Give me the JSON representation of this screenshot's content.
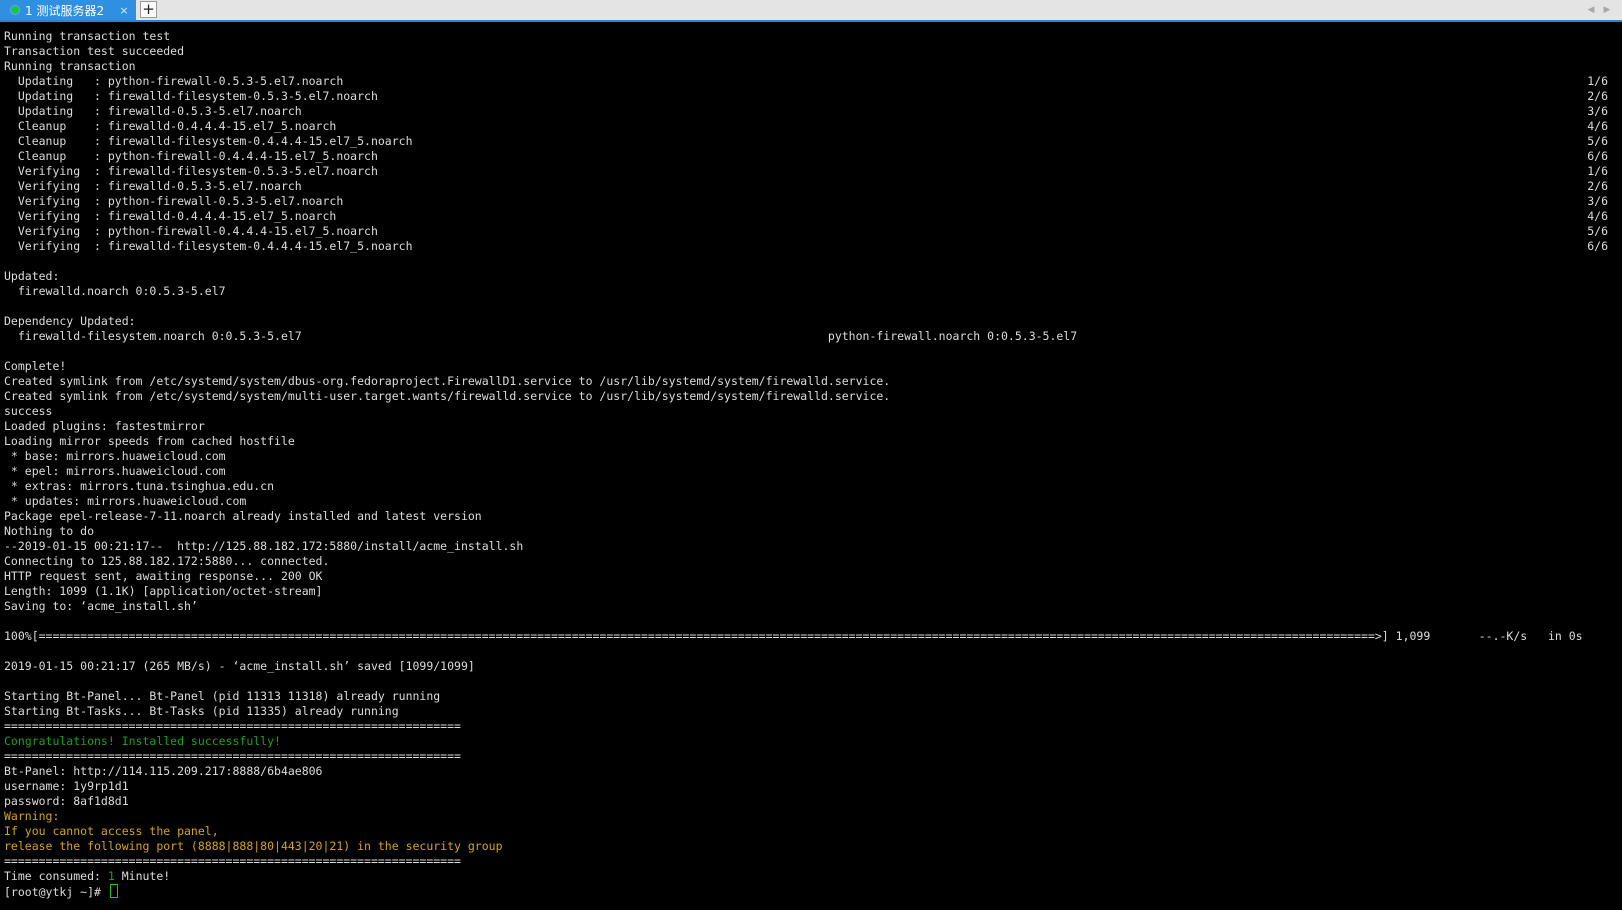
{
  "tab": {
    "title": "1 测试服务器2",
    "close": "×",
    "add": "+"
  },
  "colors": {
    "accent": "#2f8fe0",
    "status": "#19c44a",
    "terminal_bg": "#000000",
    "terminal_fg": "#dcdcdc",
    "success_green": "#1aa11a",
    "warning_yellow": "#d6a218"
  },
  "icons": {
    "status": "green-dot-icon",
    "close": "close-icon",
    "add": "plus-icon",
    "scroll_left": "chevron-left-icon",
    "scroll_right": "chevron-right-icon"
  },
  "terminal": {
    "lines": [
      "Running transaction test",
      "Transaction test succeeded",
      "Running transaction",
      "  Updating   : python-firewall-0.5.3-5.el7.noarch",
      "  Updating   : firewalld-filesystem-0.5.3-5.el7.noarch",
      "  Updating   : firewalld-0.5.3-5.el7.noarch",
      "  Cleanup    : firewalld-0.4.4.4-15.el7_5.noarch",
      "  Cleanup    : firewalld-filesystem-0.4.4.4-15.el7_5.noarch",
      "  Cleanup    : python-firewall-0.4.4.4-15.el7_5.noarch",
      "  Verifying  : firewalld-filesystem-0.5.3-5.el7.noarch",
      "  Verifying  : firewalld-0.5.3-5.el7.noarch",
      "  Verifying  : python-firewall-0.5.3-5.el7.noarch",
      "  Verifying  : firewalld-0.4.4.4-15.el7_5.noarch",
      "  Verifying  : python-firewall-0.4.4.4-15.el7_5.noarch",
      "  Verifying  : firewalld-filesystem-0.4.4.4-15.el7_5.noarch",
      "",
      "Updated:",
      "  firewalld.noarch 0:0.5.3-5.el7",
      "",
      "Dependency Updated:",
      "  firewalld-filesystem.noarch 0:0.5.3-5.el7                                                                            python-firewall.noarch 0:0.5.3-5.el7",
      "",
      "Complete!",
      "Created symlink from /etc/systemd/system/dbus-org.fedoraproject.FirewallD1.service to /usr/lib/systemd/system/firewalld.service.",
      "Created symlink from /etc/systemd/system/multi-user.target.wants/firewalld.service to /usr/lib/systemd/system/firewalld.service.",
      "success",
      "Loaded plugins: fastestmirror",
      "Loading mirror speeds from cached hostfile",
      " * base: mirrors.huaweicloud.com",
      " * epel: mirrors.huaweicloud.com",
      " * extras: mirrors.tuna.tsinghua.edu.cn",
      " * updates: mirrors.huaweicloud.com",
      "Package epel-release-7-11.noarch already installed and latest version",
      "Nothing to do",
      "--2019-01-15 00:21:17--  http://125.88.182.172:5880/install/acme_install.sh",
      "Connecting to 125.88.182.172:5880... connected.",
      "HTTP request sent, awaiting response... 200 OK",
      "Length: 1099 (1.1K) [application/octet-stream]",
      "Saving to: ‘acme_install.sh’",
      "",
      "100%[=================================================================================================================================================================================================>] 1,099       --.-K/s   in 0s",
      "",
      "2019-01-15 00:21:17 (265 MB/s) - ‘acme_install.sh’ saved [1099/1099]",
      "",
      "Starting Bt-Panel... Bt-Panel (pid 11313 11318) already running",
      "Starting Bt-Tasks... Bt-Tasks (pid 11335) already running",
      "==================================================================",
      "Congratulations! Installed successfully!",
      "==================================================================",
      "Bt-Panel: http://114.115.209.217:8888/6b4ae806",
      "username: 1y9rp1d1",
      "password: 8af1d8d1",
      "Warning:",
      "If you cannot access the panel,",
      "release the following port (8888|888|80|443|20|21) in the security group",
      "==================================================================",
      "Time consumed: ",
      "[root@ytkj ~]# "
    ],
    "progress_counters": [
      "1/6",
      "2/6",
      "3/6",
      "4/6",
      "5/6",
      "6/6",
      "1/6",
      "2/6",
      "3/6",
      "4/6",
      "5/6",
      "6/6"
    ],
    "time_consumed": {
      "value": "1",
      "unit": " Minute!"
    }
  }
}
